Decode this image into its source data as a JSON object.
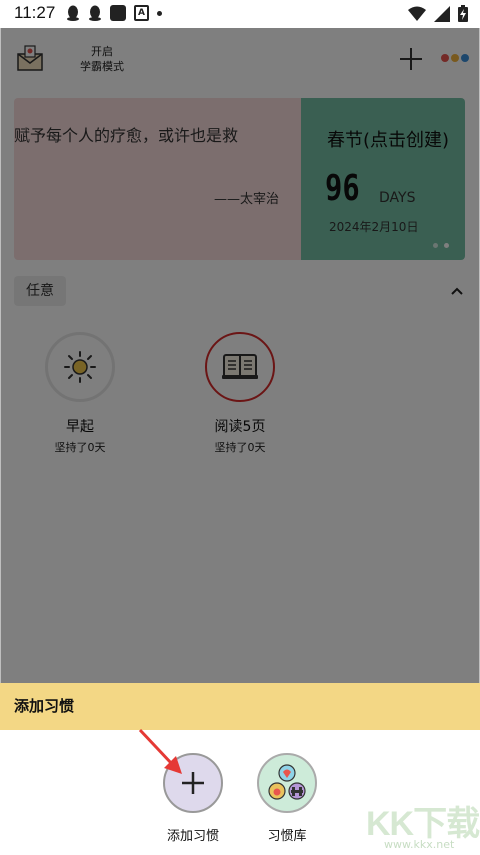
{
  "status_bar": {
    "time": "11:27"
  },
  "header": {
    "mode_line1": "开启",
    "mode_line2": "学霸模式"
  },
  "quote": {
    "text": "赋予每个人的疗愈，或许也是救",
    "author": "——太宰治"
  },
  "countdown": {
    "title": "春节(点击创建)",
    "days": "96",
    "unit": "DAYS",
    "date": "2024年2月10日"
  },
  "category": {
    "label": "任意"
  },
  "habits": [
    {
      "name": "早起",
      "days": "坚持了0天",
      "icon": "sun-icon"
    },
    {
      "name": "阅读5页",
      "days": "坚持了0天",
      "icon": "book-icon"
    }
  ],
  "sheet": {
    "title": "添加习惯",
    "options": [
      {
        "label": "添加习惯",
        "icon": "plus-icon"
      },
      {
        "label": "习惯库",
        "icon": "habit-library-icon"
      }
    ]
  },
  "watermark": {
    "main": "KK下载",
    "sub": "www.kkx.net"
  },
  "colors": {
    "sheet_header": "#f3d785",
    "quote_card": "#f8dcdc",
    "count_card": "#75bfa4",
    "more_dots": [
      "#e8554e",
      "#f2b33d",
      "#3b8fd9"
    ],
    "arrow": "#e53935"
  }
}
